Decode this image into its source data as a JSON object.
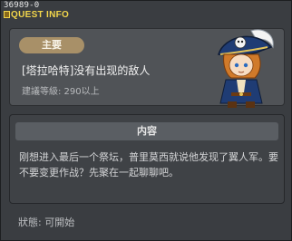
{
  "window": {
    "quest_id": "36989-0",
    "title": "QUEST INFO"
  },
  "header": {
    "tag_label": "主要",
    "quest_name": "[塔拉哈特]没有出现的敌人",
    "recommend_level": "建議等級: 290以上"
  },
  "content": {
    "section_title": "内容",
    "description": "刚想进入最后一个祭坛，普里莫西就说他发现了翼人军。要不要变更作战？先聚在一起聊聊吧。"
  },
  "footer": {
    "status": "狀態:  可開始"
  },
  "colors": {
    "title_yellow": "#f2d64b",
    "tag_bg": "#a89068",
    "panel_bg": "#505357"
  },
  "icons": {
    "quest_icon": "quest-book-icon",
    "portrait": "npc-pirate-portrait"
  }
}
